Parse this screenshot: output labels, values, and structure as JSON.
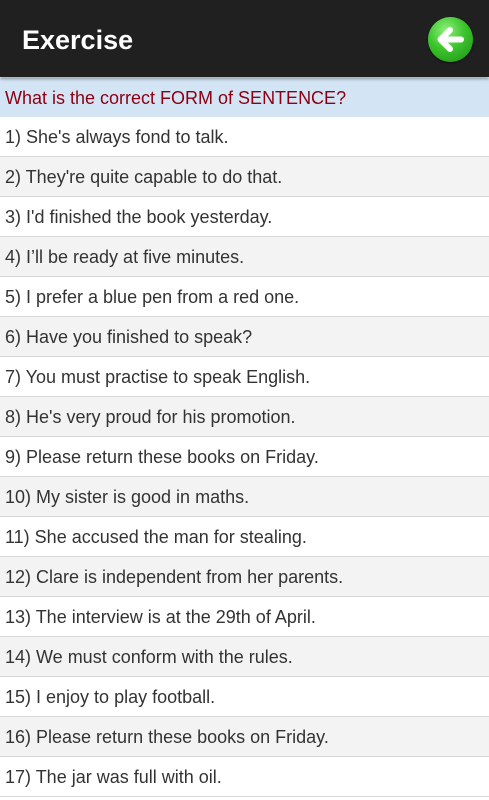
{
  "header": {
    "title": "Exercise",
    "back_button_icon": "arrow-left-icon",
    "back_button_color": "#2db52a"
  },
  "question": {
    "text": "What is the correct FORM of SENTENCE?",
    "color": "#8b0012",
    "background": "#d3e4f4"
  },
  "sentences": [
    "1) She's always fond to talk.",
    "2) They're quite capable to do that.",
    "3) I'd finished the book yesterday.",
    "4) I’ll be ready at five minutes.",
    "5) I prefer a blue pen from a red one.",
    "6) Have you finished to speak?",
    "7) You must practise to speak English.",
    "8) He's very proud for his promotion.",
    "9) Please return these books on Friday.",
    "10) My sister is good in maths.",
    "11) She accused the man for stealing.",
    "12) Clare is independent from her parents.",
    "13) The interview is at the 29th of April.",
    "14) We must conform with the rules.",
    "15) I enjoy to play football.",
    "16) Please return these books on Friday.",
    "17) The jar was full with oil."
  ]
}
